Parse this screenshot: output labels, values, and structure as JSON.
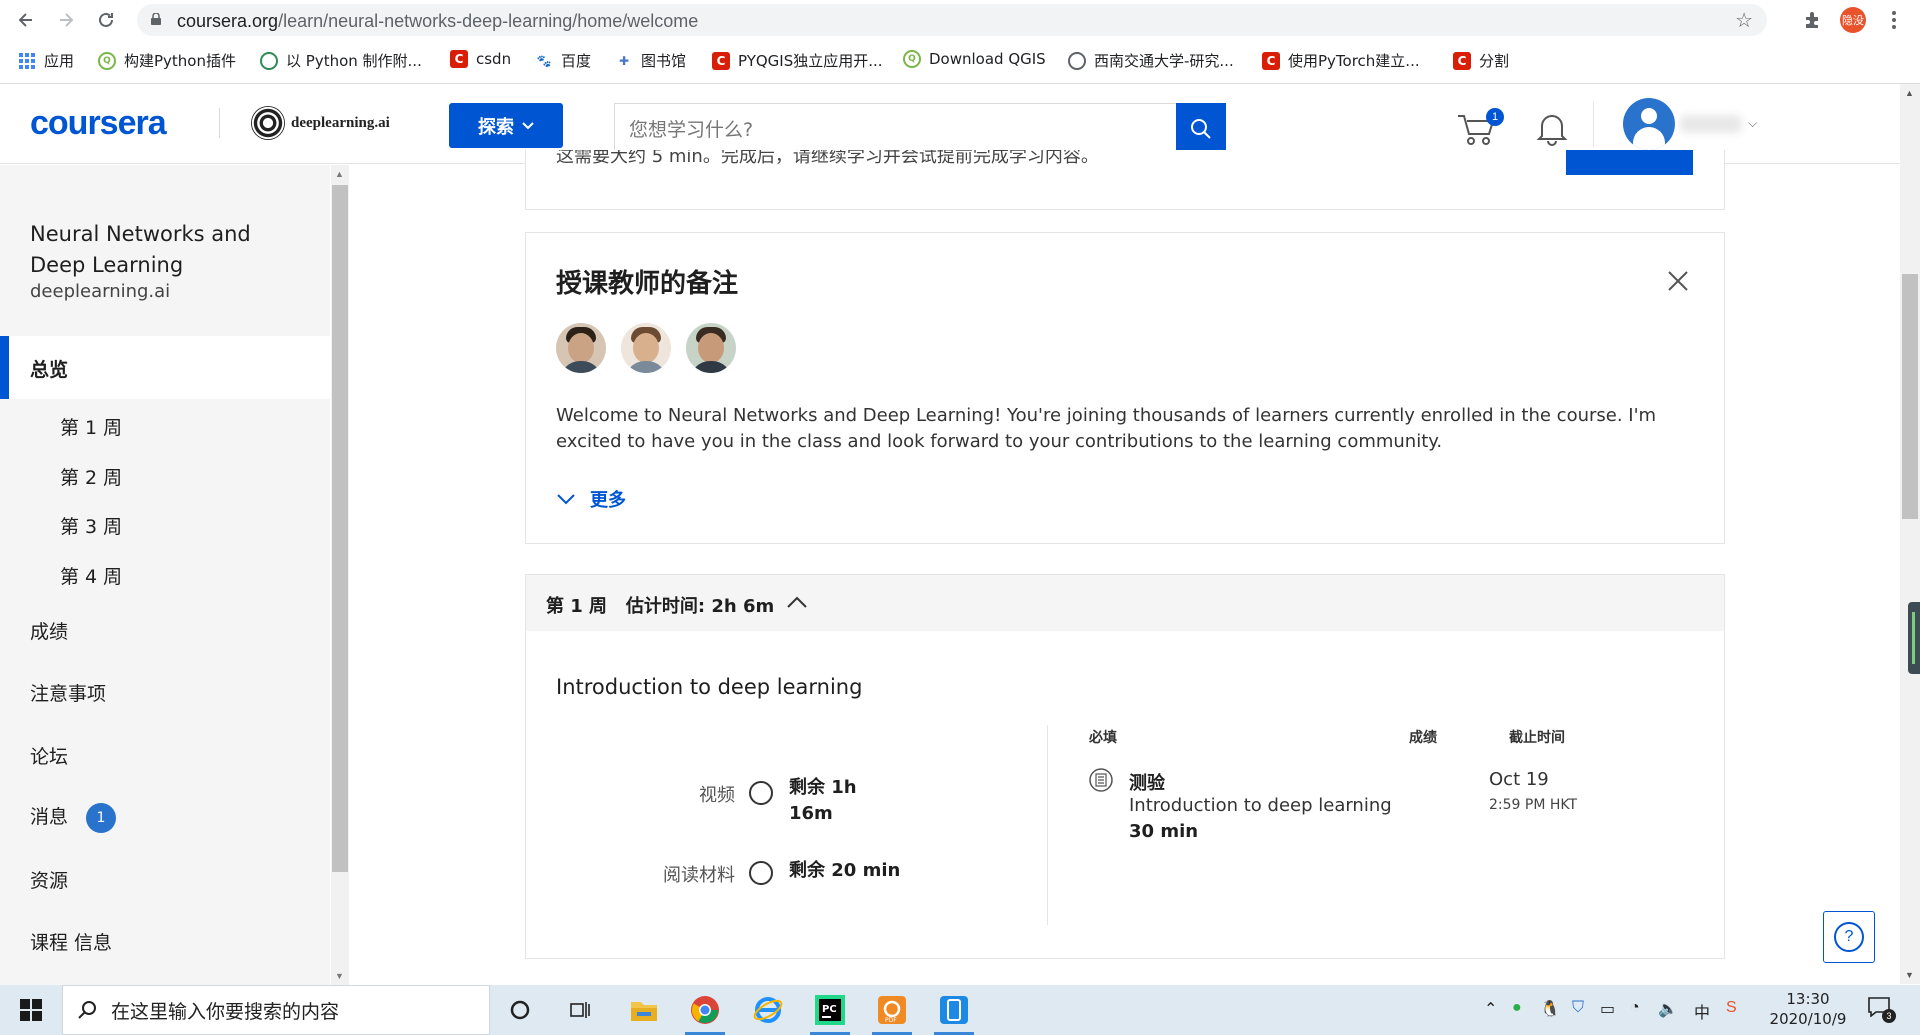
{
  "browser": {
    "url_host": "coursera.org",
    "url_path": "/learn/neural-networks-deep-learning/home/welcome",
    "profile_label": "隐没",
    "bookmarks": [
      {
        "label": "应用",
        "icon": "apps-grid-icon"
      },
      {
        "label": "构建Python插件",
        "icon": "qgis-icon"
      },
      {
        "label": "以 Python 制作附...",
        "icon": "globe-green-icon"
      },
      {
        "label": "csdn",
        "icon": "csdn-icon"
      },
      {
        "label": "百度",
        "icon": "baidu-icon"
      },
      {
        "label": "图书馆",
        "icon": "library-icon"
      },
      {
        "label": "PYQGIS独立应用开...",
        "icon": "csdn-icon"
      },
      {
        "label": "Download QGIS",
        "icon": "qgis-icon"
      },
      {
        "label": "西南交通大学-研究...",
        "icon": "globe-icon"
      },
      {
        "label": "使用PyTorch建立...",
        "icon": "csdn-icon"
      },
      {
        "label": "分割",
        "icon": "csdn-icon"
      }
    ]
  },
  "header": {
    "logo": "coursera",
    "partner": "deeplearning.ai",
    "explore_label": "探索",
    "search_placeholder": "您想学习什么?",
    "cart_count": "1"
  },
  "sidebar": {
    "course_title": "Neural Networks and Deep Learning",
    "provider": "deeplearning.ai",
    "active_item": "总览",
    "weeks": [
      "第 1 周",
      "第 2 周",
      "第 3 周",
      "第 4 周"
    ],
    "items": [
      {
        "label": "成绩"
      },
      {
        "label": "注意事项"
      },
      {
        "label": "论坛"
      },
      {
        "label": "消息",
        "badge": "1"
      },
      {
        "label": "资源"
      },
      {
        "label": "课程 信息"
      }
    ]
  },
  "main": {
    "partial_text": "这需要大约 5 min。完成后，请继续学习并会试提前完成学习内容。",
    "notes": {
      "title": "授课教师的备注",
      "body": "Welcome to Neural Networks and Deep Learning! You're joining thousands of learners currently enrolled in the course. I'm excited to have you in the class and look forward to your contributions to the learning community.",
      "more_label": "更多"
    },
    "week": {
      "label": "第 1 周",
      "estimate": "估计时间: 2h 6m",
      "module_title": "Introduction to deep learning",
      "video_label": "视频",
      "video_remaining_1": "剩余 1h",
      "video_remaining_2": "16m",
      "reading_label": "阅读材料",
      "reading_remaining": "剩余 20 min",
      "col_required": "必填",
      "col_grade": "成绩",
      "col_due": "截止时间",
      "quiz_type": "测验",
      "quiz_name": "Introduction to deep learning",
      "quiz_duration": "30 min",
      "due_date": "Oct 19",
      "due_time": "2:59 PM HKT"
    },
    "help_label": "?"
  },
  "taskbar": {
    "search_placeholder": "在这里输入你要搜索的内容",
    "time": "13:30",
    "date": "2020/10/9",
    "ime": "中",
    "notification_count": "3"
  },
  "colors": {
    "brand_blue": "#0056d2",
    "sidebar_bg": "#f5f5f5",
    "taskbar_bg": "#dfe9f2"
  }
}
